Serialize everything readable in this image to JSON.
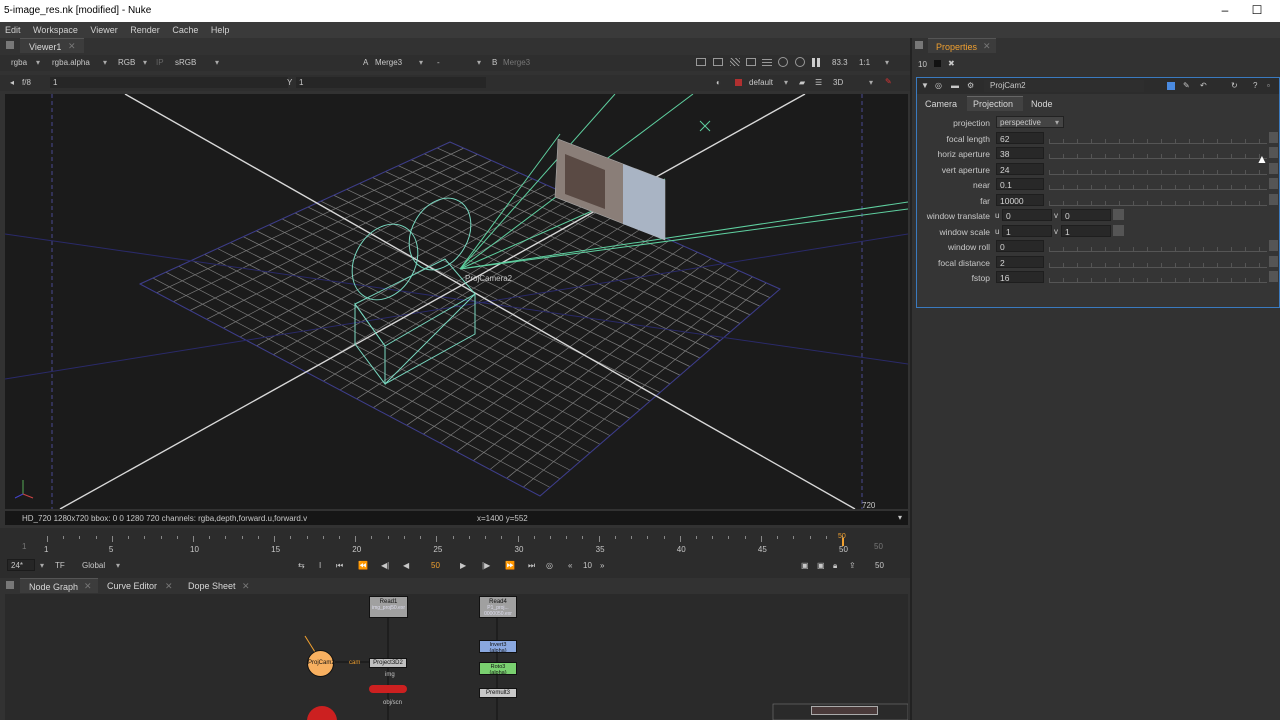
{
  "window": {
    "title": "5-image_res.nk [modified] - Nuke",
    "minimize": "–",
    "maximize": "☐"
  },
  "menu": [
    "Edit",
    "Workspace",
    "Viewer",
    "Render",
    "Cache",
    "Help"
  ],
  "viewer": {
    "tab": "Viewer1",
    "channels": "rgba",
    "alpha": "rgba.alpha",
    "colorspace_mode": "RGB",
    "ip": "IP",
    "lut": "sRGB",
    "a_label": "A",
    "a_input": "Merge3",
    "dash": "-",
    "b_label": "B",
    "b_input": "Merge3",
    "zoom": "83.3",
    "ratio": "1:1",
    "fstop": "f/8",
    "gain": "1",
    "y_label": "Y",
    "gamma": "1",
    "camera_select": "default",
    "view_mode": "3D",
    "format_label": "HD_720",
    "format_size": "720",
    "status_info": "HD_720 1280x720  bbox: 0 0 1280 720 channels: rgba,depth,forward.u,forward.v",
    "coords": "x=1400 y=552",
    "camera_label": "ProjCamera2"
  },
  "timeline": {
    "ticks": [
      "1",
      "5",
      "10",
      "15",
      "20",
      "25",
      "30",
      "35",
      "40",
      "45",
      "50"
    ],
    "start": "1",
    "end": "50",
    "current": "50",
    "fps": "24*",
    "tf": "TF",
    "scope": "Global",
    "frame_display": "50",
    "step": "10",
    "end_display": "50"
  },
  "bottom_tabs": [
    "Node Graph",
    "Curve Editor",
    "Dope Sheet"
  ],
  "nodes": {
    "read1": "Read1",
    "read1_file": "img_proj50.exr",
    "read4": "Read4",
    "read4_file": "P1_proj... 0000050.exr",
    "projcam": "ProjCam2",
    "project3d": "Project3D2",
    "cam_link": "cam",
    "img_link": "img",
    "invert": "Invert3",
    "invert_sub": "(alpha)",
    "roto": "Roto3",
    "roto_sub": "(alpha)",
    "premult": "Premult3",
    "obj_label": "obj/scn"
  },
  "properties": {
    "tab": "Properties",
    "count": "10",
    "node_name": "ProjCam2",
    "tabs": [
      "Camera",
      "Projection",
      "Node"
    ],
    "active_tab": "Projection",
    "fields": [
      {
        "label": "projection",
        "value": "perspective"
      },
      {
        "label": "focal length",
        "value": "62"
      },
      {
        "label": "horiz aperture",
        "value": "38"
      },
      {
        "label": "vert aperture",
        "value": "24"
      },
      {
        "label": "near",
        "value": "0.1"
      },
      {
        "label": "far",
        "value": "10000"
      },
      {
        "label": "window translate",
        "u": "0",
        "v": "0"
      },
      {
        "label": "window scale",
        "u": "1",
        "v": "1"
      },
      {
        "label": "window roll",
        "value": "0"
      },
      {
        "label": "focal distance",
        "value": "2"
      },
      {
        "label": "fstop",
        "value": "16"
      }
    ],
    "u_label": "u",
    "v_label": "v"
  },
  "colors": {
    "accent": "#f0a030",
    "bg": "#323232",
    "viewer_bg": "#1a1a1a",
    "grid": "#7a7a7a",
    "frustum": "#5fd0a0",
    "projcam_node": "#f8b060",
    "invert_node": "#8aa8e0",
    "roto_node": "#7ad070",
    "project_node": "#cc2020"
  }
}
